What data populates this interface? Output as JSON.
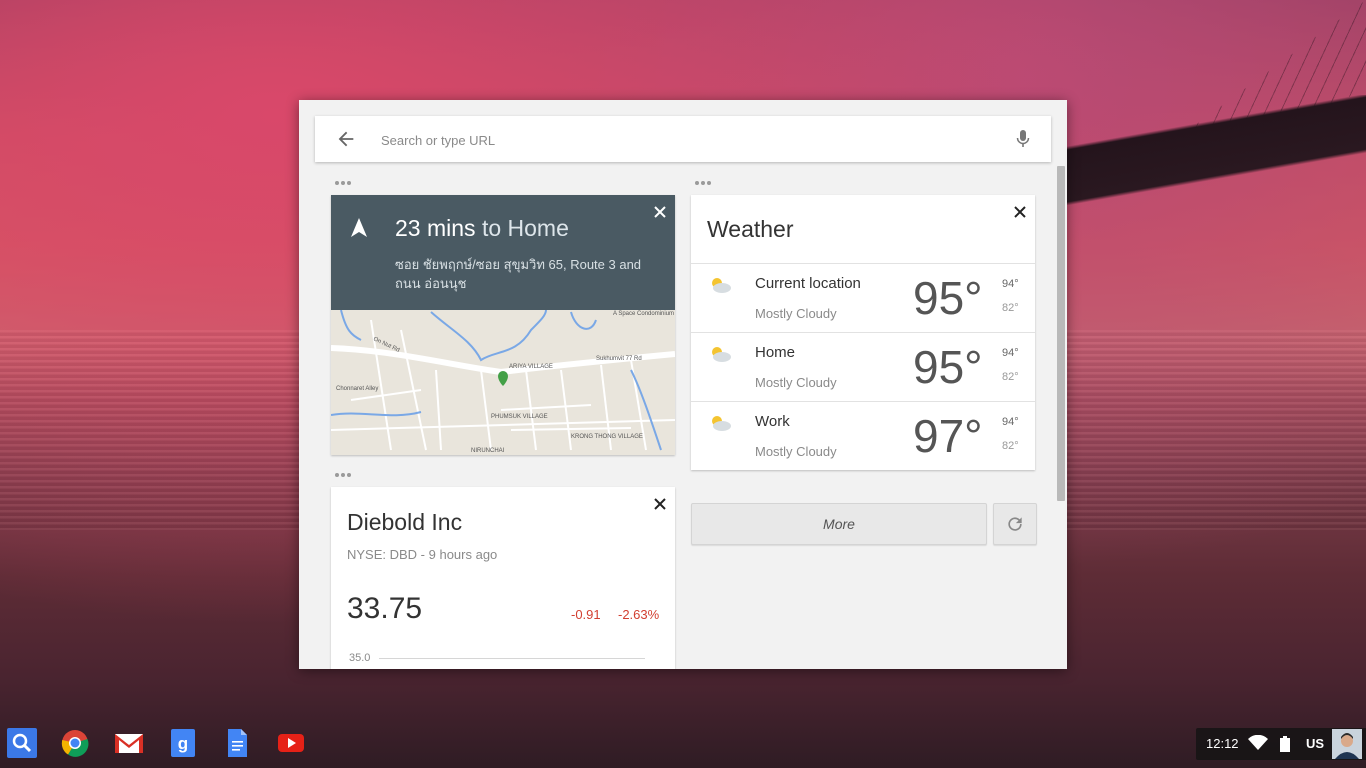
{
  "search": {
    "placeholder": "Search or type URL"
  },
  "traffic_card": {
    "duration": "23 mins",
    "destination_text": "to Home",
    "route": "ซอย ชัยพฤกษ์/ซอย สุขุมวิท 65, Route 3 and ถนน อ่อนนุช",
    "map_labels": {
      "condo": "A Space Condominium",
      "on_nut_rd": "On Nut Rd",
      "ariya_village": "ARIYA VILLAGE",
      "sukhumvit": "Sukhumvit 77 Rd",
      "phumsuk": "PHUMSUK VILLAGE",
      "krong_thong": "KRONG THONG VILLAGE",
      "nirunchai": "NIRUNCHAI",
      "chonnaret": "Chonnaret Alley"
    }
  },
  "stock_card": {
    "name": "Diebold Inc",
    "exchange_line": "NYSE: DBD - 9 hours ago",
    "price": "33.75",
    "change": "-0.91",
    "change_pct": "-2.63%",
    "axis_label": "35.0",
    "colors": {
      "negative": "#d23f31"
    }
  },
  "weather_card": {
    "title": "Weather",
    "rows": [
      {
        "location": "Current location",
        "condition": "Mostly Cloudy",
        "temp": "95°",
        "high": "94°",
        "low": "82°",
        "icon": "partly-cloudy-icon"
      },
      {
        "location": "Home",
        "condition": "Mostly Cloudy",
        "temp": "95°",
        "high": "94°",
        "low": "82°",
        "icon": "partly-cloudy-icon"
      },
      {
        "location": "Work",
        "condition": "Mostly Cloudy",
        "temp": "97°",
        "high": "94°",
        "low": "82°",
        "icon": "partly-cloudy-icon"
      }
    ]
  },
  "actions": {
    "more_label": "More"
  },
  "shelf": {
    "apps": [
      "launcher-search-icon",
      "chrome-icon",
      "gmail-icon",
      "google-search-icon",
      "docs-icon",
      "youtube-icon"
    ]
  },
  "tray": {
    "time": "12:12",
    "input_method": "US"
  }
}
